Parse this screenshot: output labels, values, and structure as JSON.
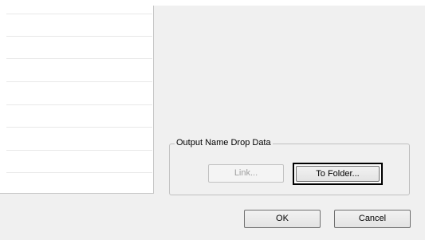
{
  "output_group": {
    "title": "Output Name Drop Data",
    "link_button": "Link...",
    "to_folder_button": "To Folder..."
  },
  "footer": {
    "ok_button": "OK",
    "cancel_button": "Cancel"
  },
  "colors": {
    "dialog_background": "#f0f0f0",
    "list_background": "#ffffff",
    "disabled_text": "#a0a0a0",
    "highlight_border": "#000000"
  }
}
